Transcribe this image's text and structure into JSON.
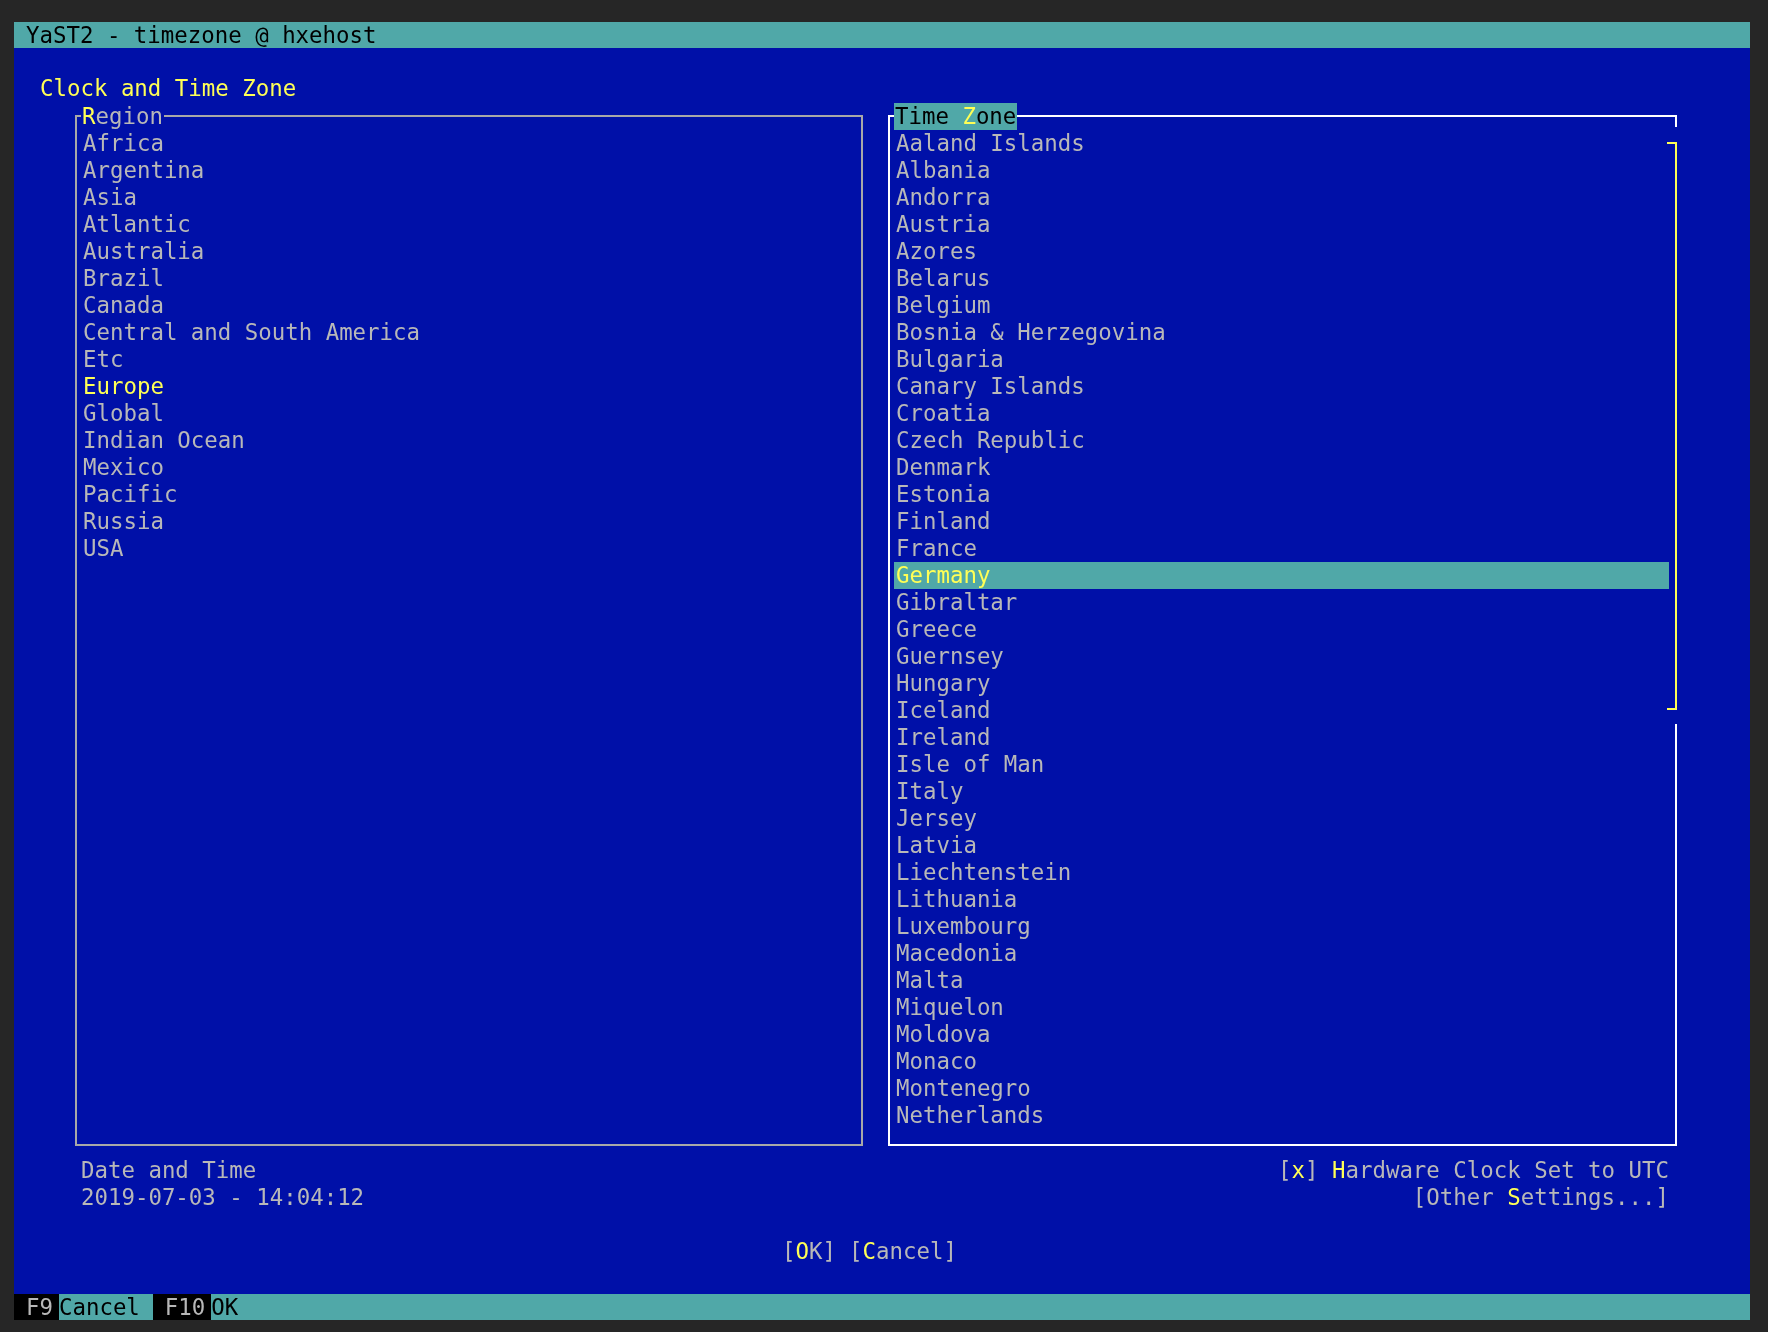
{
  "window": {
    "title": "YaST2 - timezone @ hxehost"
  },
  "heading": "Clock and Time Zone",
  "region": {
    "label": {
      "key": "R",
      "post": "egion"
    },
    "focused": false,
    "items": [
      {
        "label": "Africa",
        "selected": false
      },
      {
        "label": "Argentina",
        "selected": false
      },
      {
        "label": "Asia",
        "selected": false
      },
      {
        "label": "Atlantic",
        "selected": false
      },
      {
        "label": "Australia",
        "selected": false
      },
      {
        "label": "Brazil",
        "selected": false
      },
      {
        "label": "Canada",
        "selected": false
      },
      {
        "label": "Central and South America",
        "selected": false
      },
      {
        "label": "Etc",
        "selected": false
      },
      {
        "label": "Europe",
        "selected": true
      },
      {
        "label": "Global",
        "selected": false
      },
      {
        "label": "Indian Ocean",
        "selected": false
      },
      {
        "label": "Mexico",
        "selected": false
      },
      {
        "label": "Pacific",
        "selected": false
      },
      {
        "label": "Russia",
        "selected": false
      },
      {
        "label": "USA",
        "selected": false
      }
    ]
  },
  "time_zone": {
    "label": {
      "pre": "Time ",
      "key": "Z",
      "post": "one"
    },
    "focused": true,
    "items": [
      {
        "label": "Aaland Islands",
        "selected": false
      },
      {
        "label": "Albania",
        "selected": false
      },
      {
        "label": "Andorra",
        "selected": false
      },
      {
        "label": "Austria",
        "selected": false
      },
      {
        "label": "Azores",
        "selected": false
      },
      {
        "label": "Belarus",
        "selected": false
      },
      {
        "label": "Belgium",
        "selected": false
      },
      {
        "label": "Bosnia & Herzegovina",
        "selected": false
      },
      {
        "label": "Bulgaria",
        "selected": false
      },
      {
        "label": "Canary Islands",
        "selected": false
      },
      {
        "label": "Croatia",
        "selected": false
      },
      {
        "label": "Czech Republic",
        "selected": false
      },
      {
        "label": "Denmark",
        "selected": false
      },
      {
        "label": "Estonia",
        "selected": false
      },
      {
        "label": "Finland",
        "selected": false
      },
      {
        "label": "France",
        "selected": false
      },
      {
        "label": "Germany",
        "selected": true
      },
      {
        "label": "Gibraltar",
        "selected": false
      },
      {
        "label": "Greece",
        "selected": false
      },
      {
        "label": "Guernsey",
        "selected": false
      },
      {
        "label": "Hungary",
        "selected": false
      },
      {
        "label": "Iceland",
        "selected": false
      },
      {
        "label": "Ireland",
        "selected": false
      },
      {
        "label": "Isle of Man",
        "selected": false
      },
      {
        "label": "Italy",
        "selected": false
      },
      {
        "label": "Jersey",
        "selected": false
      },
      {
        "label": "Latvia",
        "selected": false
      },
      {
        "label": "Liechtenstein",
        "selected": false
      },
      {
        "label": "Lithuania",
        "selected": false
      },
      {
        "label": "Luxembourg",
        "selected": false
      },
      {
        "label": "Macedonia",
        "selected": false
      },
      {
        "label": "Malta",
        "selected": false
      },
      {
        "label": "Miquelon",
        "selected": false
      },
      {
        "label": "Moldova",
        "selected": false
      },
      {
        "label": "Monaco",
        "selected": false
      },
      {
        "label": "Montenegro",
        "selected": false
      },
      {
        "label": "Netherlands",
        "selected": false
      }
    ]
  },
  "date_time": {
    "label": "Date and Time",
    "value": "2019-07-03 - 14:04:12"
  },
  "hardware_clock": {
    "box_left": "[",
    "mark": "x",
    "box_right": "]",
    "checked": true,
    "label": {
      "key": "H",
      "post": "ardware Clock Set to UTC"
    }
  },
  "other_settings": {
    "pre": "[Other ",
    "key": "S",
    "post": "ettings...]"
  },
  "buttons": [
    {
      "pre": "[",
      "key": "O",
      "post": "K]"
    },
    {
      "pre": "[",
      "key": "C",
      "post": "ancel]"
    }
  ],
  "function_keys": [
    {
      "key": "F9",
      "label": "Cancel"
    },
    {
      "key": "F10",
      "label": "OK"
    }
  ]
}
